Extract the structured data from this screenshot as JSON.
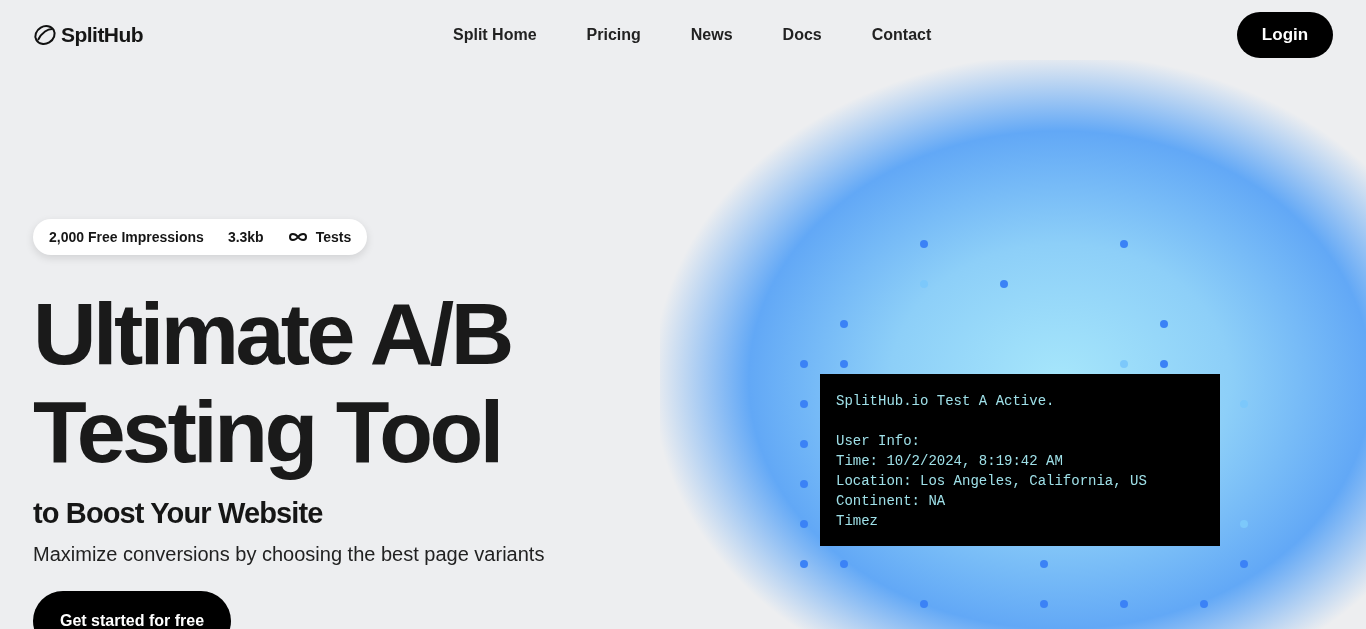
{
  "header": {
    "brand": "SplitHub",
    "links": [
      "Split Home",
      "Pricing",
      "News",
      "Docs",
      "Contact"
    ],
    "login": "Login"
  },
  "hero": {
    "badges": [
      {
        "kind": "text",
        "text": "2,000 Free Impressions"
      },
      {
        "kind": "text",
        "text": "3.3kb"
      },
      {
        "kind": "infinity",
        "text": "Tests"
      }
    ],
    "heading": [
      "Ultimate A/B",
      "Testing Tool"
    ],
    "subheading": "to Boost Your Website",
    "description": "Maximize conversions by choosing the best page variants",
    "cta": "Get started for free"
  },
  "terminal": {
    "status": "SplitHub.io Test A Active.",
    "info": [
      "User Info:",
      "Time: 10/2/2024, 8:19:42 AM",
      "Location: Los Angeles, California, US",
      "Continent: NA",
      "Timez"
    ]
  }
}
